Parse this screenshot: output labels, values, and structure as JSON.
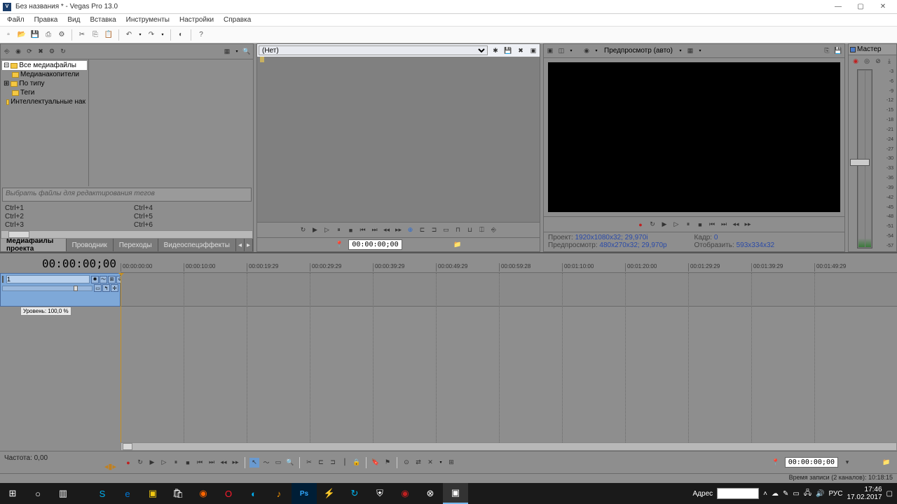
{
  "titlebar": {
    "title": "Без названия * - Vegas Pro 13.0"
  },
  "menu": [
    "Файл",
    "Правка",
    "Вид",
    "Вставка",
    "Инструменты",
    "Настройки",
    "Справка"
  ],
  "explorer": {
    "tree": [
      {
        "label": "Все медиафайлы",
        "sel": true
      },
      {
        "label": "Медианакопители"
      },
      {
        "label": "По типу"
      },
      {
        "label": "Теги"
      },
      {
        "label": "Интеллектуальные нак"
      }
    ],
    "tag_placeholder": "Выбрать файлы для редактирования тегов",
    "shortcuts": [
      "Ctrl+1",
      "Ctrl+4",
      "Ctrl+2",
      "Ctrl+5",
      "Ctrl+3",
      "Ctrl+6"
    ]
  },
  "tabs": [
    {
      "label": "Медиафайлы проекта",
      "active": true
    },
    {
      "label": "Проводник"
    },
    {
      "label": "Переходы"
    },
    {
      "label": "Видеоспецэффекты"
    }
  ],
  "trimmer": {
    "dropdown": "(Нет)",
    "timecode": "00:00:00;00"
  },
  "preview": {
    "quality_label": "Предпросмотр (авто)",
    "project_label": "Проект:",
    "project_val": "1920x1080x32; 29,970i",
    "preview_label": "Предпросмотр:",
    "preview_val": "480x270x32; 29,970p",
    "frame_label": "Кадр:",
    "frame_val": "0",
    "display_label": "Отобразить:",
    "display_val": "593x334x32"
  },
  "master": {
    "title": "Мастер",
    "scale": [
      "-3",
      "-6",
      "-9",
      "-12",
      "-15",
      "-18",
      "-21",
      "-24",
      "-27",
      "-30",
      "-33",
      "-36",
      "-39",
      "-42",
      "-45",
      "-48",
      "-51",
      "-54",
      "-57"
    ]
  },
  "timeline": {
    "cursor_tc": "00:00:00;00",
    "ruler": [
      "00:00:00:00",
      "00:00:10:00",
      "00:00:19:29",
      "00:00:29:29",
      "00:00:39:29",
      "00:00:49:29",
      "00:00:59:28",
      "00:01:10:00",
      "00:01:20:00",
      "00:01:29:29",
      "00:01:39:29",
      "00:01:49:29"
    ],
    "track1": {
      "num": "1",
      "level_label": "Уровень: 100,0 %"
    },
    "footer_freq": "Частота: 0,00",
    "footer_tc": "00:00:00;00"
  },
  "rec_status": "Время записи (2 каналов): 10:18:15",
  "tray": {
    "addr_label": "Адрес",
    "lang": "РУС",
    "time": "17:46",
    "date": "17.02.2017"
  }
}
